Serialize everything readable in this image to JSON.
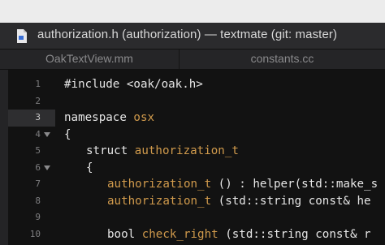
{
  "window": {
    "title": "authorization.h (authorization) — textmate (git: master)",
    "file_icon": "document-icon"
  },
  "tabs": [
    {
      "label": "OakTextView.mm"
    },
    {
      "label": "constants.cc"
    }
  ],
  "editor": {
    "current_line": 3,
    "lines": [
      {
        "n": "1",
        "fold": false
      },
      {
        "n": "2",
        "fold": false
      },
      {
        "n": "3",
        "fold": false
      },
      {
        "n": "4",
        "fold": true
      },
      {
        "n": "5",
        "fold": false
      },
      {
        "n": "6",
        "fold": true
      },
      {
        "n": "7",
        "fold": false
      },
      {
        "n": "8",
        "fold": false
      },
      {
        "n": "9",
        "fold": false
      },
      {
        "n": "10",
        "fold": false
      }
    ],
    "code": {
      "l1": "#include <oak/oak.h>",
      "l3_kw": "namespace",
      "l3_name": "osx",
      "l4": "{",
      "l5_kw": "struct",
      "l5_name": "authorization_t",
      "l6": "{",
      "l7_fn": "authorization_t",
      "l7_rest": " () : helper(std::make_s",
      "l8_fn": "authorization_t",
      "l8_rest": " (std::string const& he",
      "l10_kw": "bool",
      "l10_fn": "check_right",
      "l10_rest": " (std::string const& r"
    }
  },
  "colors": {
    "background": "#121212",
    "highlight": "#d09a4c",
    "text": "#e6e6e6"
  }
}
